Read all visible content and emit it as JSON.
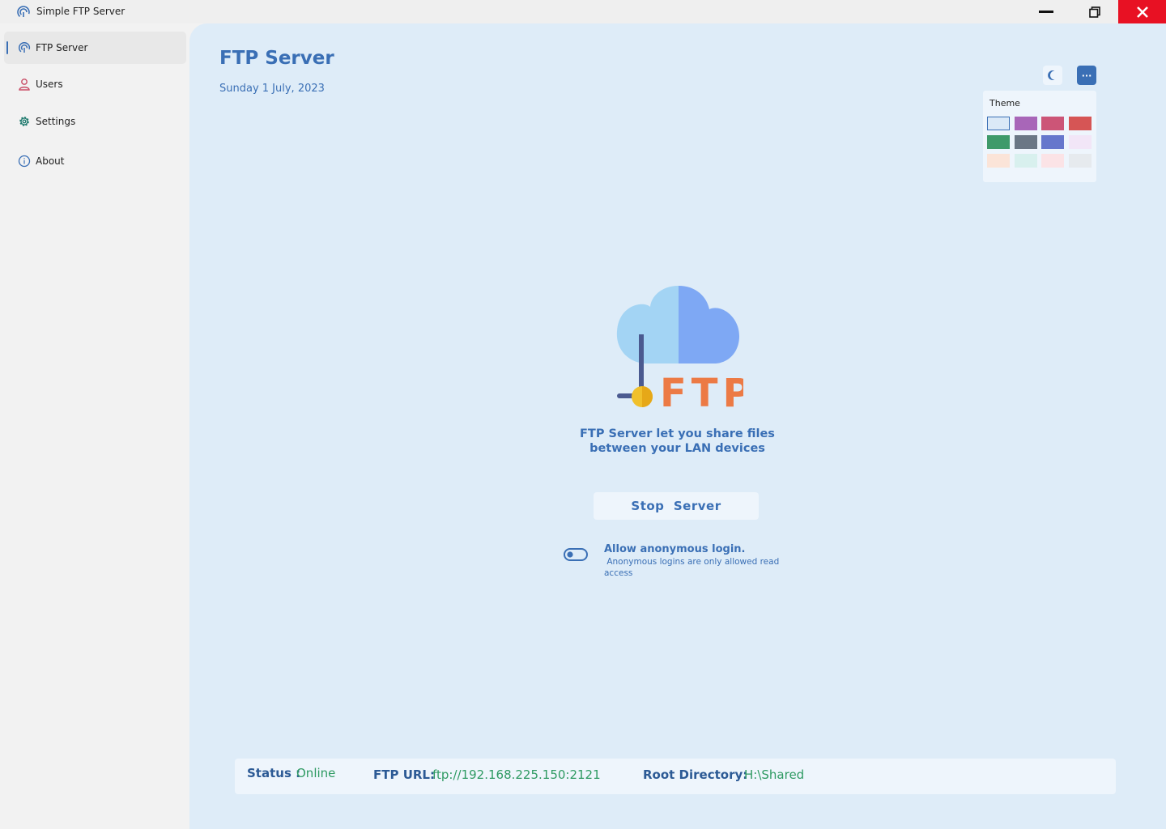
{
  "window": {
    "title": "Simple FTP Server"
  },
  "sidebar": {
    "items": [
      {
        "label": "FTP Server",
        "icon": "ftp-broadcast-icon",
        "active": true
      },
      {
        "label": "Users",
        "icon": "user-icon",
        "active": false
      },
      {
        "label": "Settings",
        "icon": "gear-icon",
        "active": false
      },
      {
        "label": "About",
        "icon": "info-icon",
        "active": false
      }
    ]
  },
  "main": {
    "title": "FTP Server",
    "date": "Sunday 1 July, 2023",
    "description_line1": "FTP Server let you share files",
    "description_line2": "between your LAN devices",
    "stop_button": "Stop  Server",
    "hero_logo_text": "FTP"
  },
  "toolbar": {
    "more_label": "···",
    "dark_mode_icon": "moon-icon",
    "more_icon": "ellipsis-icon"
  },
  "theme": {
    "label": "Theme",
    "swatches": [
      "#dbe9f7",
      "#a866b8",
      "#cc5577",
      "#d65555",
      "#3f9a6a",
      "#6b7785",
      "#6677cc",
      "#f2e6f7",
      "#fbe4d8",
      "#d8f0ee",
      "#fbe3e6",
      "#e6eaee"
    ],
    "selected_index": 0
  },
  "anonymous": {
    "title": "Allow anonymous login.",
    "subtitle": " Anonymous logins are only allowed read access",
    "enabled": false
  },
  "status": {
    "status_label": "Status :",
    "status_value": "Online",
    "url_label": "FTP URL:",
    "url_value": "ftp://192.168.225.150:2121",
    "root_label": "Root Directory:",
    "root_value": "H:\\Shared"
  },
  "colors": {
    "accent": "#3a6fb5",
    "status_green": "#2e9a62",
    "close_red": "#e81123",
    "main_bg": "#deecf8"
  }
}
